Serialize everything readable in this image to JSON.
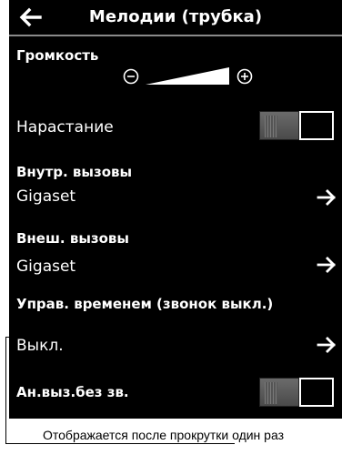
{
  "header": {
    "title": "Мелодии (трубка)"
  },
  "volume": {
    "label": "Громкость",
    "level": 0.85
  },
  "crescendo": {
    "label": "Нарастание",
    "state": "off"
  },
  "internal_calls": {
    "header": "Внутр. вызовы",
    "value": "Gigaset"
  },
  "external_calls": {
    "header": "Внеш. вызовы",
    "value": "Gigaset"
  },
  "time_control": {
    "header": "Управ. временем (звонок выкл.)",
    "value": "Выкл."
  },
  "anon_silent": {
    "label": "Ан.выз.без зв.",
    "state": "off"
  },
  "annotation": {
    "text": "Отображается после прокрутки один раз"
  }
}
